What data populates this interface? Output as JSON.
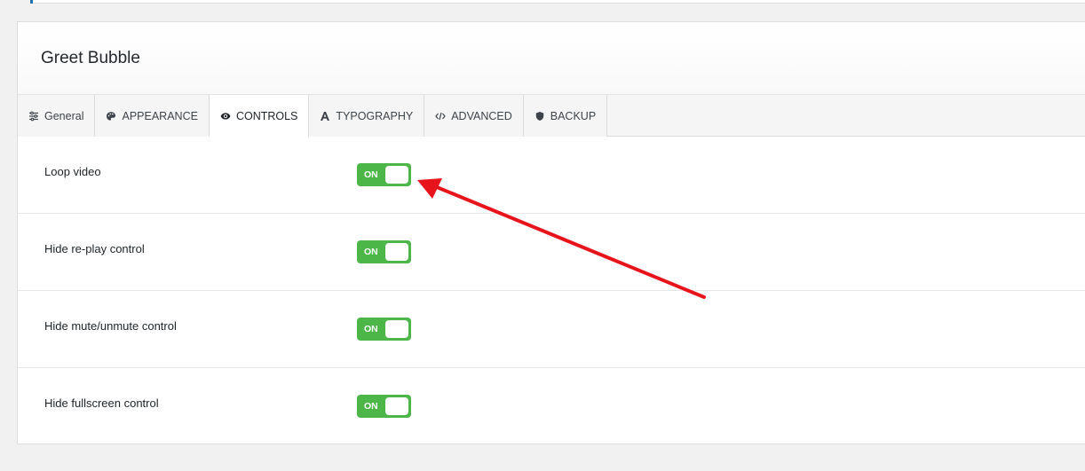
{
  "panel": {
    "title": "Greet Bubble"
  },
  "tabs": [
    {
      "label": "General",
      "icon": "sliders-icon"
    },
    {
      "label": "APPEARANCE",
      "icon": "palette-icon"
    },
    {
      "label": "CONTROLS",
      "icon": "eye-icon",
      "active": true
    },
    {
      "label": "TYPOGRAPHY",
      "icon": "font-icon"
    },
    {
      "label": "ADVANCED",
      "icon": "code-icon"
    },
    {
      "label": "BACKUP",
      "icon": "shield-icon"
    }
  ],
  "rows": [
    {
      "label": "Loop video",
      "toggle": "ON"
    },
    {
      "label": "Hide re-play control",
      "toggle": "ON"
    },
    {
      "label": "Hide mute/unmute control",
      "toggle": "ON"
    },
    {
      "label": "Hide fullscreen control",
      "toggle": "ON"
    }
  ],
  "colors": {
    "toggle_on": "#4cb748",
    "annotation_arrow": "#e8141b",
    "accent": "#2271b1"
  }
}
